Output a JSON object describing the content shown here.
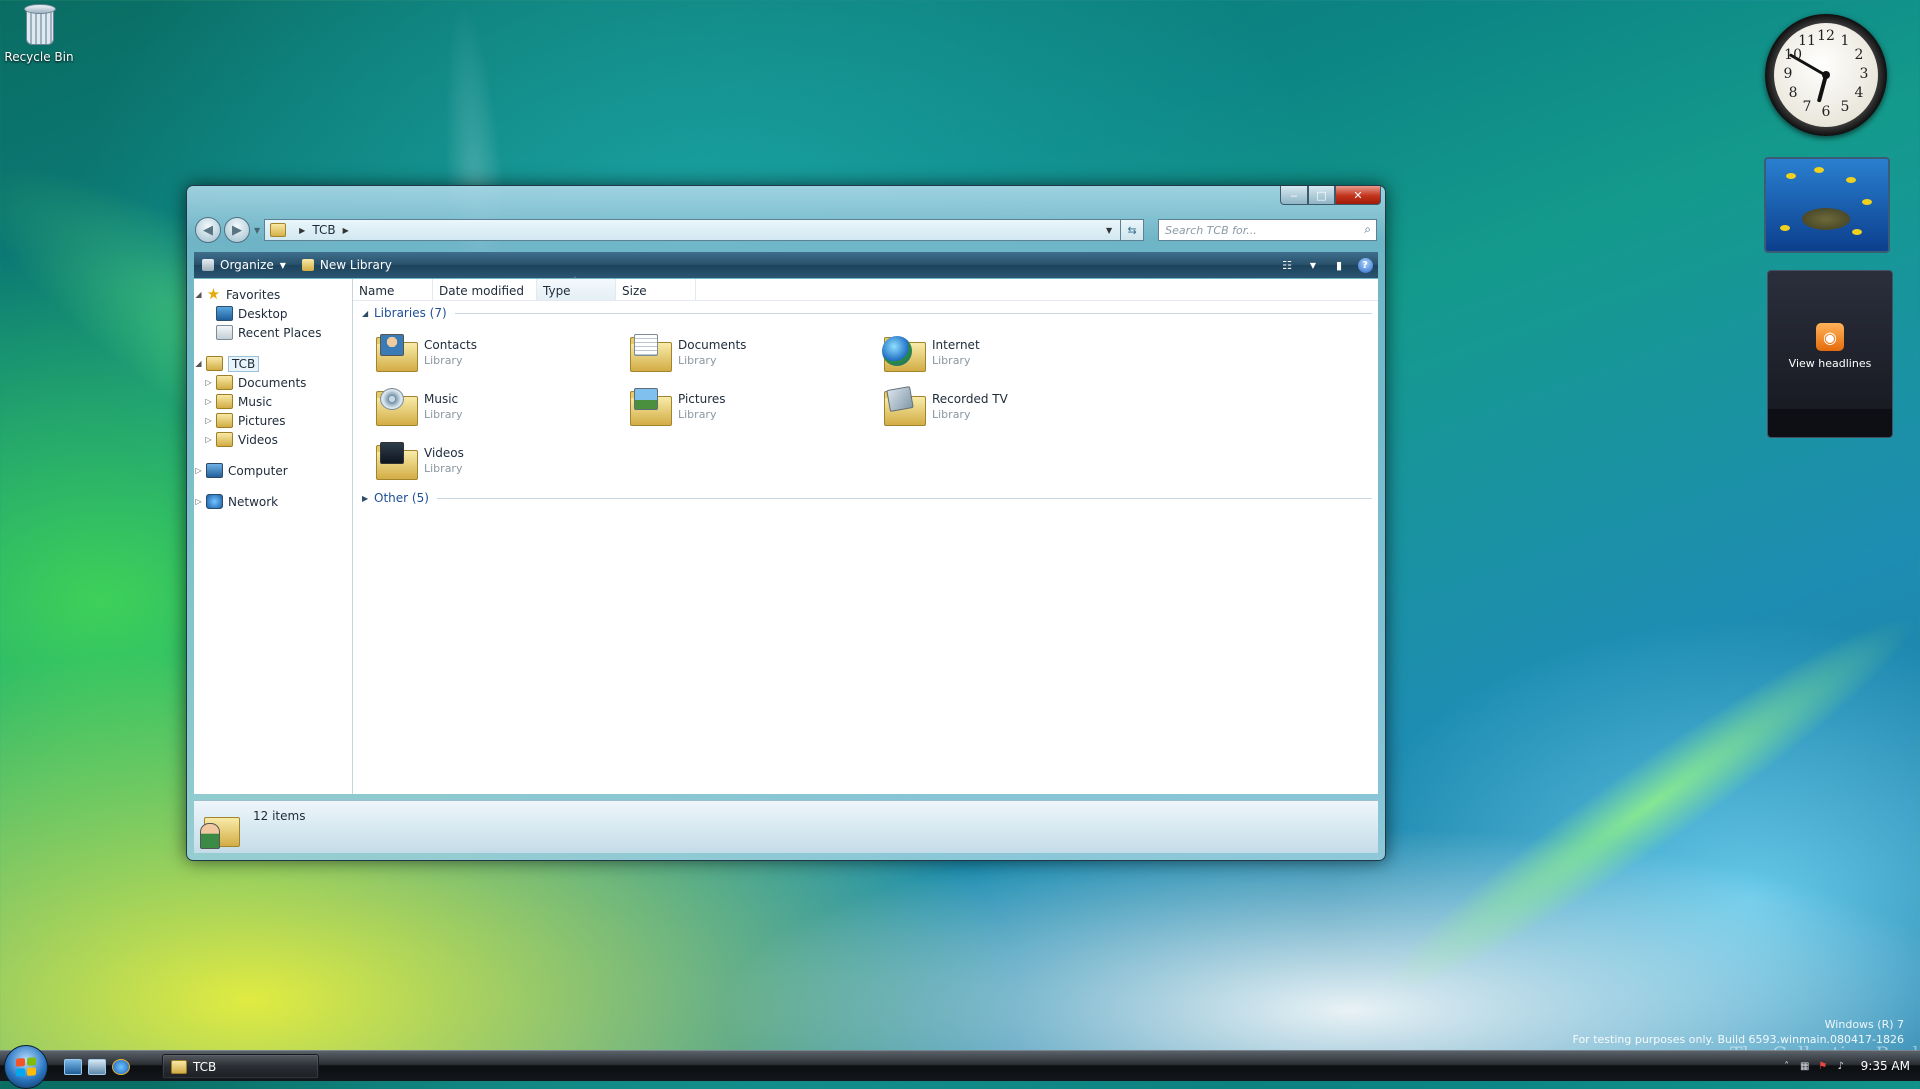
{
  "desktop": {
    "recycle_bin": "Recycle Bin"
  },
  "window": {
    "buttons": {
      "minimize": "‒",
      "maximize": "□",
      "close": "✕"
    },
    "address": {
      "segments": [
        "TCB"
      ]
    },
    "search_placeholder": "Search TCB for...",
    "toolbar": {
      "organize": "Organize",
      "new_library": "New Library"
    },
    "nav_pane": {
      "favorites": "Favorites",
      "favorites_items": [
        "Desktop",
        "Recent Places"
      ],
      "root": "TCB",
      "root_items": [
        "Documents",
        "Music",
        "Pictures",
        "Videos"
      ],
      "computer": "Computer",
      "network": "Network"
    },
    "columns": [
      "Name",
      "Date modified",
      "Type",
      "Size"
    ],
    "groups": {
      "libraries": "Libraries (7)",
      "other": "Other (5)"
    },
    "libraries": [
      {
        "name": "Contacts",
        "type": "Library",
        "icon": "contacts"
      },
      {
        "name": "Documents",
        "type": "Library",
        "icon": "docs"
      },
      {
        "name": "Internet",
        "type": "Library",
        "icon": "internet"
      },
      {
        "name": "Music",
        "type": "Library",
        "icon": "music"
      },
      {
        "name": "Pictures",
        "type": "Library",
        "icon": "pictures"
      },
      {
        "name": "Recorded TV",
        "type": "Library",
        "icon": "tv"
      },
      {
        "name": "Videos",
        "type": "Library",
        "icon": "videos"
      }
    ],
    "status": "12 items"
  },
  "gadgets": {
    "feed_label": "View headlines",
    "clock_numbers": [
      "12",
      "1",
      "2",
      "3",
      "4",
      "5",
      "6",
      "7",
      "8",
      "9",
      "10",
      "11"
    ]
  },
  "watermark": {
    "line1": "Windows (R) 7",
    "line2": "For testing purposes only. Build 6593.winmain.080417-1826",
    "brand": "The Collection Book"
  },
  "taskbar": {
    "active_window": "TCB",
    "time": "9:35 AM"
  },
  "colors": {
    "taskbar": "#1a1e22",
    "command_bar": "#284f69",
    "link_blue": "#1e4f98"
  }
}
